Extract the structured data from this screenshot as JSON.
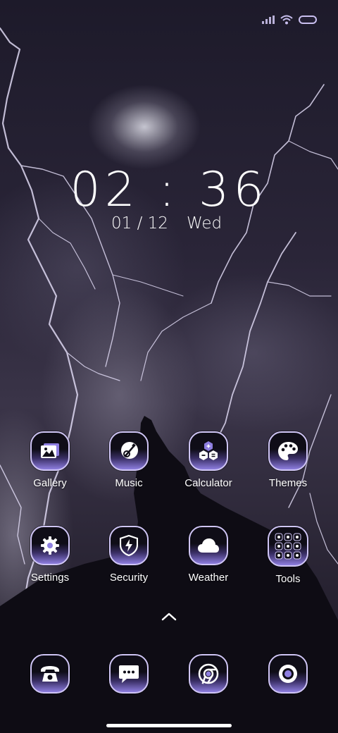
{
  "clock": {
    "time": "02 : 36",
    "date": "01 / 12",
    "day": "Wed"
  },
  "apps": [
    {
      "name": "gallery",
      "label": "Gallery",
      "icon": "gallery-icon"
    },
    {
      "name": "music",
      "label": "Music",
      "icon": "guitar-icon"
    },
    {
      "name": "calculator",
      "label": "Calculator",
      "icon": "calculator-icon"
    },
    {
      "name": "themes",
      "label": "Themes",
      "icon": "palette-icon"
    },
    {
      "name": "settings",
      "label": "Settings",
      "icon": "gear-icon"
    },
    {
      "name": "security",
      "label": "Security",
      "icon": "shield-bolt-icon"
    },
    {
      "name": "weather",
      "label": "Weather",
      "icon": "cloud-icon"
    },
    {
      "name": "tools",
      "label": "Tools",
      "icon": "folder-grid-icon"
    }
  ],
  "dock": [
    {
      "name": "phone",
      "icon": "phone-icon"
    },
    {
      "name": "messages",
      "icon": "message-icon"
    },
    {
      "name": "browser",
      "icon": "chrome-icon"
    },
    {
      "name": "camera",
      "icon": "camera-lens-icon"
    }
  ],
  "theme": {
    "accent": "#8e7ee0",
    "icon_border": "#cfc5f5",
    "icon_dark": "#0f0d17"
  }
}
